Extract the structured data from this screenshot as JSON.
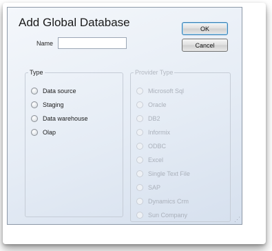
{
  "dialog": {
    "title": "Add Global Database",
    "name_label": "Name",
    "name_value": "",
    "ok_label": "OK",
    "cancel_label": "Cancel"
  },
  "type_group": {
    "legend": "Type",
    "options": [
      "Data source",
      "Staging",
      "Data warehouse",
      "Olap"
    ],
    "selected": null
  },
  "provider_group": {
    "legend": "Provider Type",
    "enabled": false,
    "options": [
      "Microsoft Sql",
      "Oracle",
      "DB2",
      "Informix",
      "ODBC",
      "Excel",
      "Single Text File",
      "SAP",
      "Dynamics Crm",
      "Sun Company"
    ]
  },
  "colors": {
    "dialog_bg": "#e5ecf5",
    "default_button_border": "#3c7fb1",
    "disabled_text": "#aab0ba"
  }
}
